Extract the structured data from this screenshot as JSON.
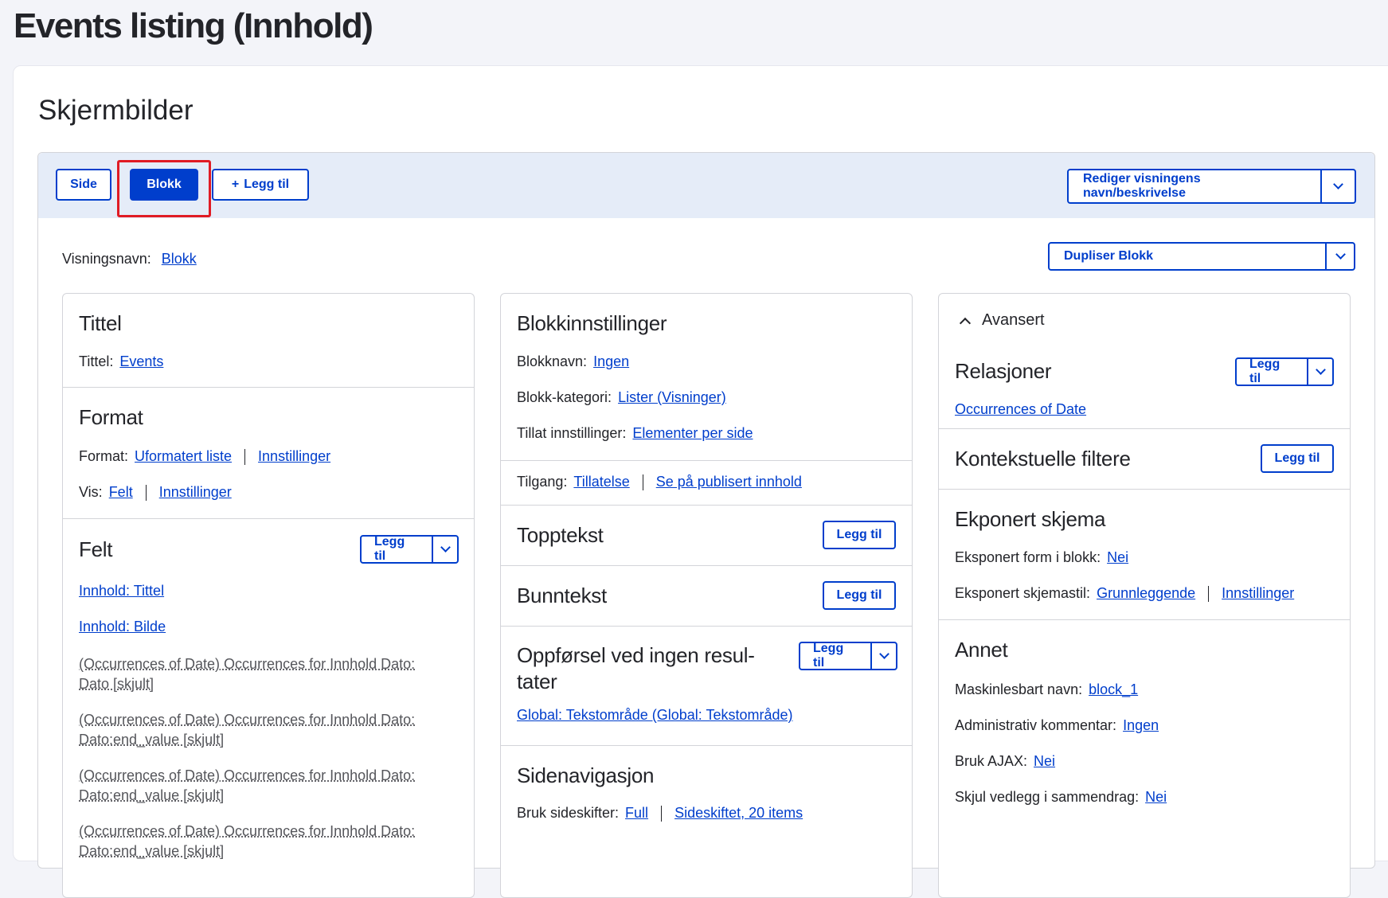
{
  "page_title": "Events listing (Innhold)",
  "section_title": "Skjermbilder",
  "tabs": {
    "side": "Side",
    "blokk": "Blokk",
    "add": "Legg til",
    "edit_name": "Rediger visningens navn/beskrivelse"
  },
  "display": {
    "name_label": "Visningsnavn:",
    "name_value": "Blokk",
    "duplicate": "Dupliser Blokk"
  },
  "col1": {
    "title_heading": "Tittel",
    "title_label": "Tittel:",
    "title_value": "Events",
    "format_heading": "Format",
    "format_label": "Format:",
    "format_value": "Uformatert liste",
    "format_settings": "Innstillinger",
    "show_label": "Vis:",
    "show_value": "Felt",
    "show_settings": "Innstillinger",
    "fields_heading": "Felt",
    "fields_add": "Legg til",
    "fields": [
      "Innhold: Tittel",
      "Innhold: Bilde",
      "(Occurrences of Date) Occurrences for Innhold Dato: Dato [skjult]",
      "(Occurrences of Date) Occurrences for Innhold Dato: Dato:end_value [skjult]",
      "(Occurrences of Date) Occurrences for Innhold Dato: Dato:end_value [skjult]",
      "(Occurrences of Date) Occurrences for Innhold Dato: Dato:end_value [skjult]"
    ]
  },
  "col2": {
    "block_heading": "Blokkinnstillinger",
    "block_name_label": "Blokknavn:",
    "block_name_value": "Ingen",
    "block_cat_label": "Blokk-kategori:",
    "block_cat_value": "Lister (Visninger)",
    "allow_label": "Tillat innstillinger:",
    "allow_value": "Elementer per side",
    "access_label": "Tilgang:",
    "access_value": "Tillatelse",
    "access_value2": "Se på publisert innhold",
    "header_heading": "Topptekst",
    "header_add": "Legg til",
    "footer_heading": "Bunntekst",
    "footer_add": "Legg til",
    "noresult_heading_1": "Oppførsel ved ingen resul-",
    "noresult_heading_2": "tater",
    "noresult_add": "Legg til",
    "noresult_value": "Global: Tekstområde (Global: Tekstområde)",
    "pager_heading": "Sidenavigasjon",
    "pager_label": "Bruk sideskifter:",
    "pager_value": "Full",
    "pager_value2": "Sideskiftet, 20 items"
  },
  "col3": {
    "advanced": "Avansert",
    "rel_heading": "Relasjoner",
    "rel_add": "Legg til",
    "rel_value": "Occurrences of Date",
    "ctx_heading": "Kontekstuelle filtere",
    "ctx_add": "Legg til",
    "exp_heading": "Ekponert skjema",
    "exp_block_label": "Eksponert form i blokk:",
    "exp_block_value": "Nei",
    "exp_style_label": "Eksponert skjemastil:",
    "exp_style_value": "Grunnleggende",
    "exp_style_settings": "Innstillinger",
    "other_heading": "Annet",
    "machine_label": "Maskinlesbart navn:",
    "machine_value": "block_1",
    "admin_label": "Administrativ kommentar:",
    "admin_value": "Ingen",
    "ajax_label": "Bruk AJAX:",
    "ajax_value": "Nei",
    "hide_label": "Skjul vedlegg i sammendrag:",
    "hide_value": "Nei"
  }
}
